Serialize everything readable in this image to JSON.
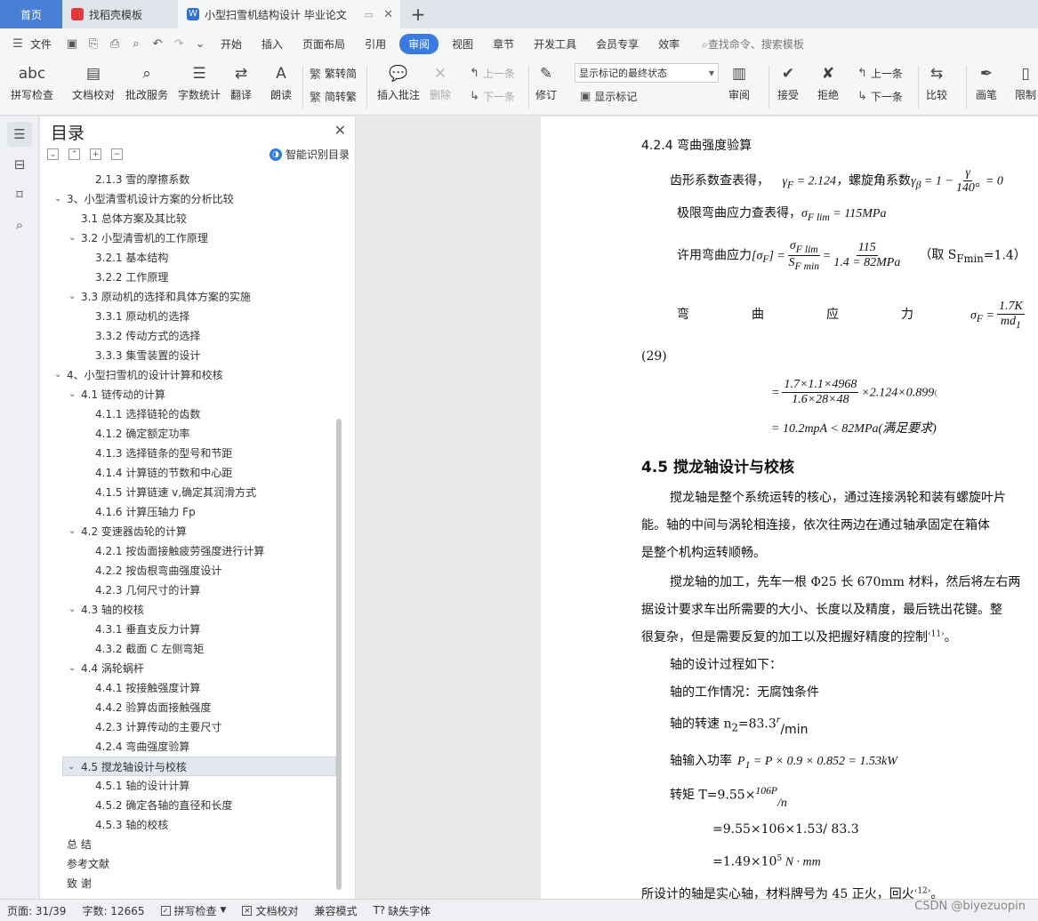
{
  "tabs": [
    {
      "label": "首页"
    },
    {
      "label": "找稻壳模板"
    },
    {
      "label": "小型扫雪机结构设计 毕业论文"
    }
  ],
  "menu": {
    "file": "文件",
    "items": [
      "开始",
      "插入",
      "页面布局",
      "引用",
      "审阅",
      "视图",
      "章节",
      "开发工具",
      "会员专享",
      "效率"
    ],
    "active": "审阅",
    "search": "查找命令、搜索模板"
  },
  "ribbon": {
    "spell": "拼写检查",
    "proof": "文档校对",
    "batch": "批改服务",
    "wordcount": "字数统计",
    "translate": "翻译",
    "read": "朗读",
    "trad": "繁转简",
    "simp": "简转繁",
    "insert_comment": "插入批注",
    "delete": "删除",
    "prev": "上一条",
    "next": "下一条",
    "revise": "修订",
    "markup_dropdown": "显示标记的最终状态",
    "show_markup": "显示标记",
    "review": "审阅",
    "accept": "接受",
    "reject": "拒绝",
    "prev2": "上一条",
    "next2": "下一条",
    "compare": "比较",
    "pen": "画笔",
    "restrict": "限制"
  },
  "toc": {
    "title": "目录",
    "smart": "智能识别目录",
    "items": [
      {
        "text": "2.1.3  雪的摩擦系数"
      },
      {
        "text": "3、小型清雪机设计方案的分析比较"
      },
      {
        "text": "3.1  总体方案及其比较"
      },
      {
        "text": "3.2  小型清雪机的工作原理"
      },
      {
        "text": "3.2.1 基本结构"
      },
      {
        "text": "3.2.2 工作原理"
      },
      {
        "text": "3.3  原动机的选择和具体方案的实施"
      },
      {
        "text": "3.3.1 原动机的选择"
      },
      {
        "text": "3.3.2  传动方式的选择"
      },
      {
        "text": "3.3.3  集雪装置的设计"
      },
      {
        "text": "4、小型扫雪机的设计计算和校核"
      },
      {
        "text": "4.1  链传动的计算"
      },
      {
        "text": "4.1.1 选择链轮的齿数"
      },
      {
        "text": "4.1.2 确定额定功率"
      },
      {
        "text": "4.1.3 选择链条的型号和节距"
      },
      {
        "text": "4.1.4 计算链的节数和中心距"
      },
      {
        "text": "4.1.5 计算链速 v,确定其润滑方式"
      },
      {
        "text": "4.1.6 计算压轴力 Fp"
      },
      {
        "text": "4.2  变速器齿轮的计算"
      },
      {
        "text": "4.2.1 按齿面接触疲劳强度进行计算"
      },
      {
        "text": "4.2.2  按齿根弯曲强度设计"
      },
      {
        "text": "4.2.3  几何尺寸的计算"
      },
      {
        "text": "4.3  轴的校核"
      },
      {
        "text": "4.3.1  垂直支反力计算"
      },
      {
        "text": "4.3.2  截面 C 左侧弯矩"
      },
      {
        "text": "4.4 涡轮蜗杆"
      },
      {
        "text": "4.4.1 按接触强度计算"
      },
      {
        "text": "4.4.2  验算齿面接触强度"
      },
      {
        "text": "4.2.3 计算传动的主要尺寸"
      },
      {
        "text": "4.2.4 弯曲强度验算"
      },
      {
        "text": "4.5 搅龙轴设计与校核"
      },
      {
        "text": "4.5.1 轴的设计计算"
      },
      {
        "text": "4.5.2 确定各轴的直径和长度"
      },
      {
        "text": "4.5.3 轴的校核"
      },
      {
        "text": "总    结"
      },
      {
        "text": "参考文献"
      },
      {
        "text": "致    谢"
      }
    ]
  },
  "doc": {
    "h424": "4.2.4 弯曲强度验算",
    "l1a": "齿形系数查表得，",
    "l1b": "γ",
    "l1c": "F",
    "l1d": " = 2.124，",
    "l1e": "螺旋角系数",
    "l1f": "γ",
    "l1g": "β",
    "l1h": " = 1 −",
    "l1i": "γ",
    "l1j": "140°",
    "l1k": " = 0",
    "l2a": "极限弯曲应力查表得，",
    "l2b": "σ",
    "l2c": "F lim",
    "l2d": " = 115MPa",
    "l3a": "许用弯曲应力",
    "l3b": "[σ",
    "l3c": "F",
    "l3d": "] =",
    "l3e": "σ",
    "l3f": "F lim",
    "l3g": "S",
    "l3h": "F min",
    "l3i": "=",
    "l3j": "115",
    "l3k": "1.4 = 82MPa",
    "l3l": "（取 S",
    "l3m": "Fmin",
    "l3n": "=1.4）",
    "l4a": "弯",
    "l4b": "曲",
    "l4c": "应",
    "l4d": "力",
    "l4e": "σ",
    "l4f": "F",
    "l4g": " =",
    "l4h": "1.7K",
    "l4i": "md",
    "l4j": "1",
    "eqnum": "(29)",
    "l5a": "=",
    "l5b": "1.7×1.1×4968",
    "l5c": "1.6×28×48",
    "l5d": "×2.124×0.899",
    "l5e": "(",
    "l6": "= 10.2mpA < 82MPa(满足要求)",
    "h45": "4.5 搅龙轴设计与校核",
    "p1": "搅龙轴是整个系统运转的核心，通过连接涡轮和装有螺旋叶片",
    "p2": "能。轴的中间与涡轮相连接，依次往两边在通过轴承固定在箱体",
    "p3": "是整个机构运转顺畅。",
    "p4": "搅龙轴的加工，先车一根 Φ25 长 670mm 材料，然后将左右两",
    "p5": "据设计要求车出所需要的大小、长度以及精度，最后铣出花键。整",
    "p6a": "很复杂，但是需要反复的加工以及把握好精度的控制",
    "p6b": "‹11›",
    "p6c": "。",
    "p7": "轴的设计过程如下：",
    "p8": "轴的工作情况：无腐蚀条件",
    "p9a": "轴的转速 n",
    "p9b": "2",
    "p9c": "=83.3",
    "p9d": "r",
    "p9e": "/min",
    "p10a": "轴输入功率",
    "p10b": "P",
    "p10c": "1",
    "p10d": " = P × 0.9 × 0.852 = 1.53kW",
    "p11a": "转矩 T=9.55×",
    "p11b": "106P",
    "p11c": "/n",
    "p12": "=9.55×106×1.53/ 83.3",
    "p13a": "=1.49×10",
    "p13b": "5",
    "p13c": " N · mm",
    "p14a": "所设计的轴是实心轴，材料牌号为 45 正火，回火",
    "p14b": "‹12›",
    "p14c": "。"
  },
  "status": {
    "page": "页面: 31/39",
    "words": "字数: 12665",
    "spell": "拼写检查",
    "proof": "文档校对",
    "compat": "兼容模式",
    "font": "缺失字体"
  },
  "watermark": "CSDN @biyezuopin"
}
